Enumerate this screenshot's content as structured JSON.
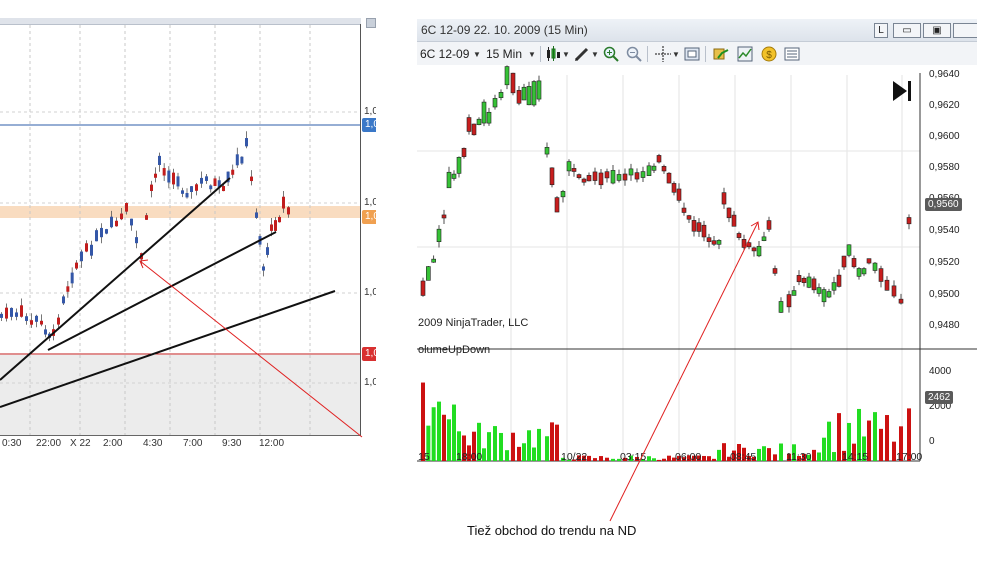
{
  "left_chart": {
    "price_labels": [
      "1,0",
      "1,0",
      "1,0",
      "1,0"
    ],
    "price_tags": [
      {
        "text": "1,0",
        "color": "#3a78c8"
      },
      {
        "text": "1,0",
        "color": "#f0a050"
      },
      {
        "text": "1,0",
        "color": "#d83030"
      }
    ],
    "x_labels": [
      "0:30",
      "22:00",
      "X 22",
      "2:00",
      "4:30",
      "7:00",
      "9:30",
      "12:00"
    ]
  },
  "nt": {
    "title": "6C 12-09  22. 10. 2009 (15 Min)",
    "window_buttons": [
      "L",
      "▭",
      "▣",
      ""
    ],
    "toolbar": {
      "instrument": "6C 12-09",
      "interval": "15 Min",
      "icons": [
        "candlestick-icon",
        "pencil-icon",
        "zoom-in-icon",
        "zoom-out-icon",
        "crosshair-icon",
        "properties-icon",
        "strategy-icon",
        "indicator-icon",
        "coin-icon",
        "data-box-icon"
      ]
    },
    "price_labels": [
      "0,9640",
      "0,9620",
      "0,9600",
      "0,9580",
      "0,9560",
      "0,9540",
      "0,9520",
      "0,9500",
      "0,9480"
    ],
    "current_price": "0,9560",
    "copyright": "2009 NinjaTrader, LLC",
    "indicator_name": "olumeUpDown",
    "volume_labels": [
      "4000",
      "2000",
      "0"
    ],
    "volume_current": "2462",
    "x_labels": [
      "15",
      "18:00",
      "10/22",
      "03:15",
      "06:00",
      "08:45",
      "11:30",
      "14:15",
      "17:00"
    ]
  },
  "annotation": "Tiež obchod do trendu na ND",
  "colors": {
    "up": "#36c236",
    "down": "#c81e1e",
    "left_blue": "#2e5ea8",
    "left_red": "#c21d1d"
  }
}
